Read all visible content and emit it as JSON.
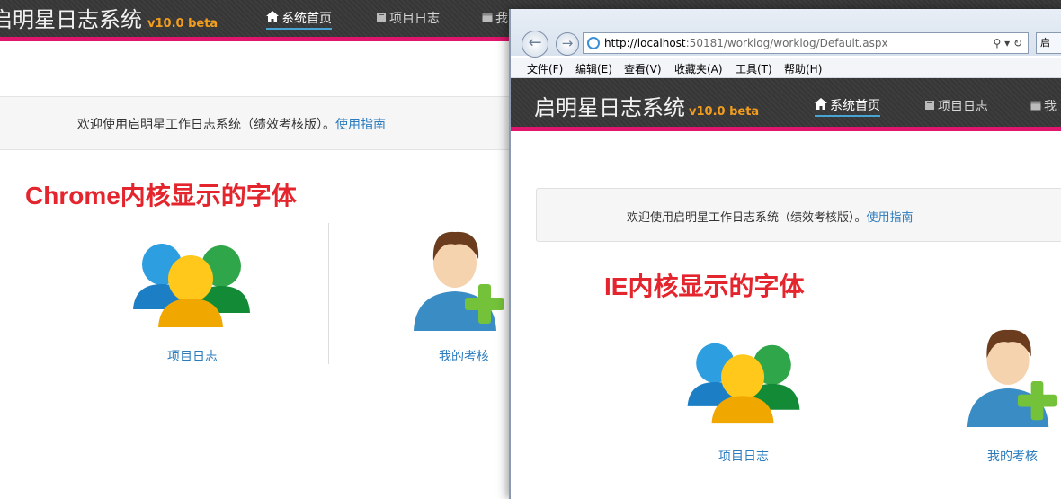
{
  "app": {
    "title": "启明星日志系统",
    "version": "v10.0 beta"
  },
  "nav": {
    "home": "系统首页",
    "project_log": "项目日志",
    "my_third_left": "我",
    "my_third_ie": "我"
  },
  "welcome": {
    "text": "欢迎使用启明星工作日志系统（绩效考核版）。",
    "guide_link": "使用指南"
  },
  "notes": {
    "chrome": "Chrome内核显示的字体",
    "ie": "IE内核显示的字体"
  },
  "tiles": {
    "project_log": "项目日志",
    "my_review": "我的考核"
  },
  "browser": {
    "url_host": "http://localhost",
    "url_rest": ":50181/worklog/worklog/Default.aspx",
    "tab_label": "启",
    "menu": [
      "文件(F)",
      "编辑(E)",
      "查看(V)",
      "收藏夹(A)",
      "工具(T)",
      "帮助(H)"
    ]
  },
  "colors": {
    "accent_bar": "#e0156d",
    "version": "#f29d1e",
    "link": "#2b7bbd",
    "note_red": "#e4252d"
  },
  "icons": [
    "home-icon",
    "book-icon",
    "calendar-icon",
    "users-group-icon",
    "user-add-icon",
    "back-arrow-icon",
    "forward-arrow-icon",
    "ie-logo-icon"
  ]
}
